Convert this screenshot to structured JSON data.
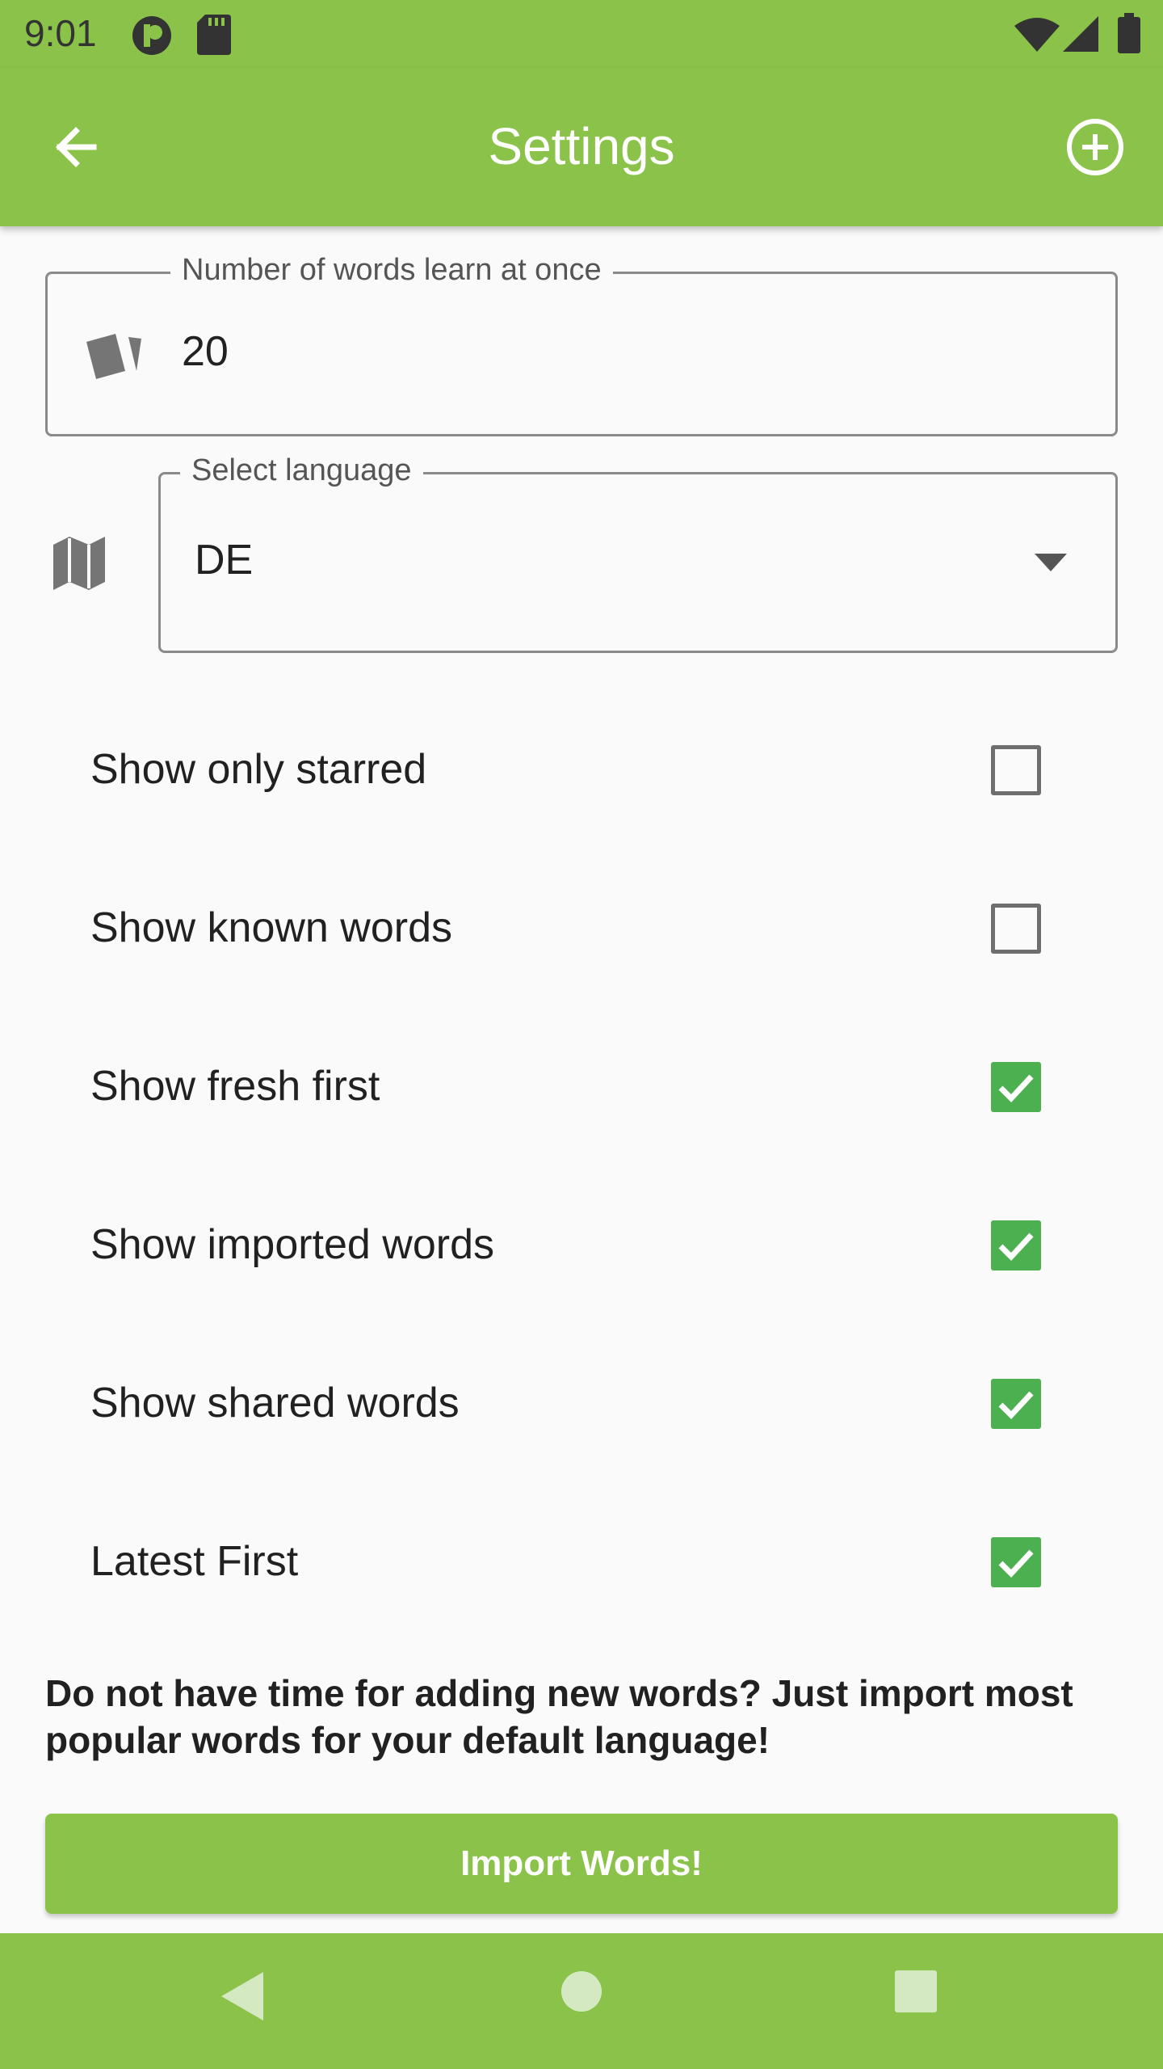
{
  "status_bar": {
    "time": "9:01"
  },
  "app_bar": {
    "title": "Settings",
    "back_icon": "arrow-left-icon",
    "add_icon": "add-circle-icon"
  },
  "words_field": {
    "label": "Number of words learn at once",
    "value": "20",
    "icon": "cards-icon"
  },
  "language_field": {
    "label": "Select language",
    "value": "DE",
    "icon": "map-icon"
  },
  "options": [
    {
      "label": "Show only starred",
      "checked": false
    },
    {
      "label": "Show known words",
      "checked": false
    },
    {
      "label": "Show fresh first",
      "checked": true
    },
    {
      "label": "Show imported words",
      "checked": true
    },
    {
      "label": "Show shared words",
      "checked": true
    },
    {
      "label": "Latest First",
      "checked": true
    }
  ],
  "import": {
    "info": "Do not have time for adding new words? Just import most popular words for your default language!",
    "button_label": "Import Words!"
  },
  "colors": {
    "primary": "#8bc34a",
    "checkbox_checked": "#4caf50"
  }
}
